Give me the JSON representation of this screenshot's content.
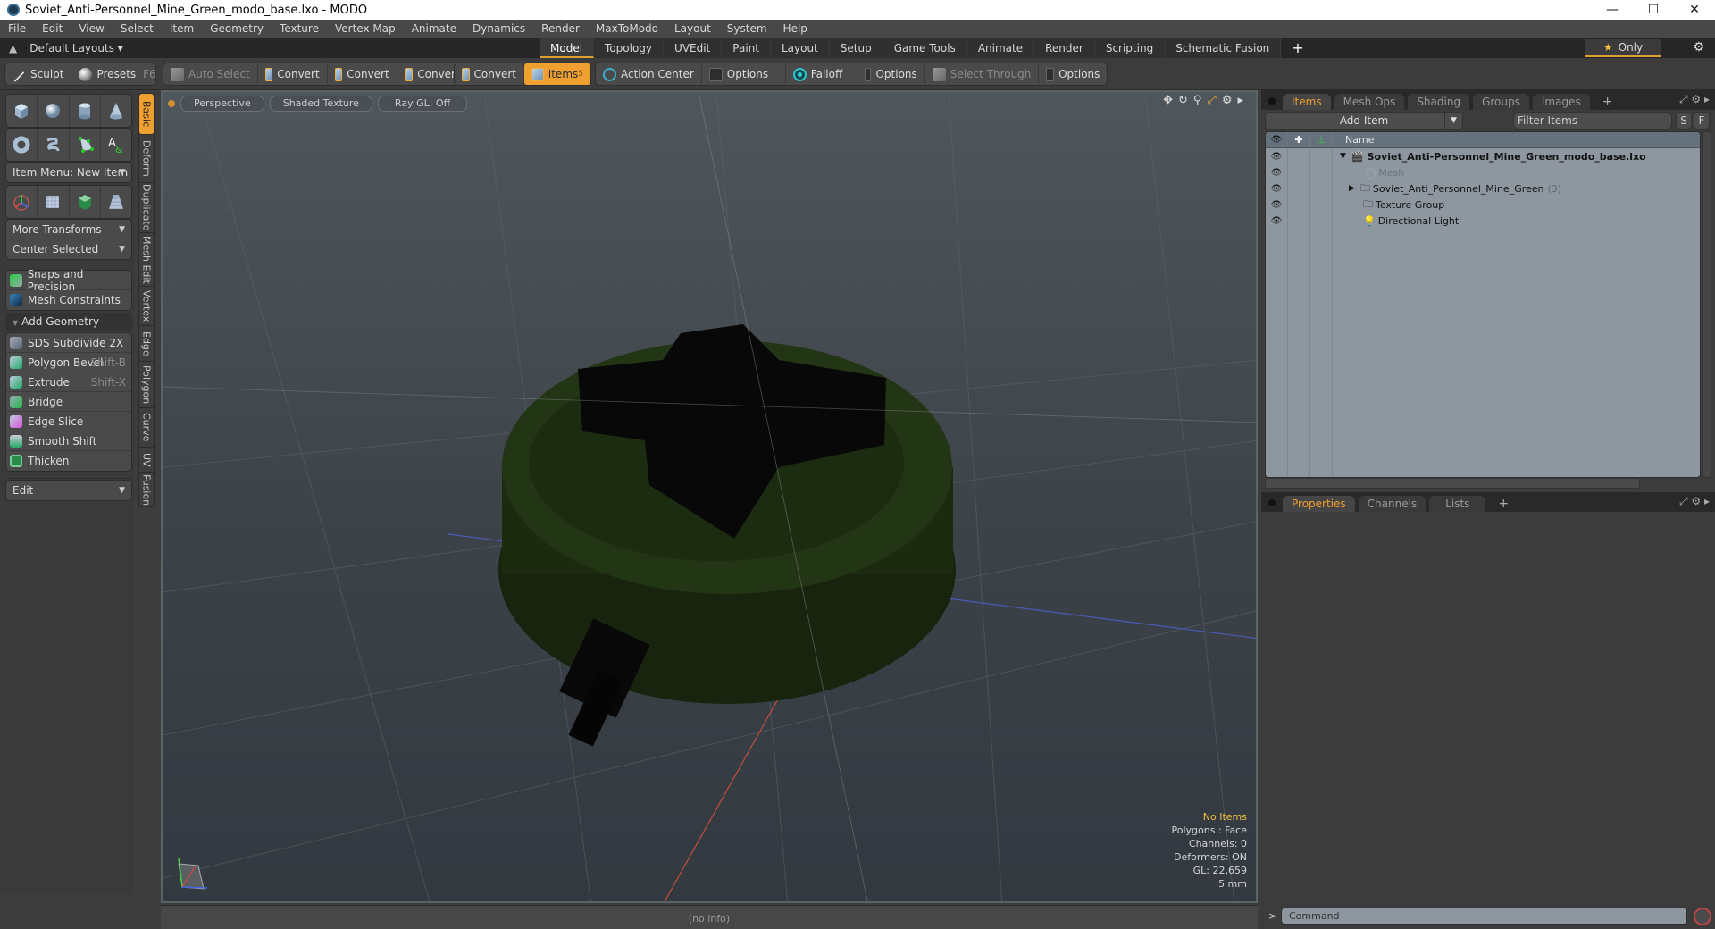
{
  "window": {
    "title": "Soviet_Anti-Personnel_Mine_Green_modo_base.lxo - MODO",
    "controls": [
      "minimize",
      "maximize",
      "close"
    ]
  },
  "menu": [
    "File",
    "Edit",
    "View",
    "Select",
    "Item",
    "Geometry",
    "Texture",
    "Vertex Map",
    "Animate",
    "Dynamics",
    "Render",
    "MaxToModo",
    "Layout",
    "System",
    "Help"
  ],
  "layout_bar": {
    "default_layouts": "Default Layouts ▾",
    "tabs": [
      "Model",
      "Topology",
      "UVEdit",
      "Paint",
      "Layout",
      "Setup",
      "Game Tools",
      "Animate",
      "Render",
      "Scripting",
      "Schematic Fusion"
    ],
    "active_tab": "Model",
    "add_tab": "+",
    "only_label": "Only"
  },
  "toolbar": {
    "sculpt": "Sculpt",
    "presets": "Presets",
    "presets_key": "F6",
    "auto_select": "Auto Select",
    "convert": "Convert",
    "items": "Items",
    "items_key": "5",
    "action_center": "Action Center",
    "options": "Options",
    "falloff": "Falloff",
    "select_through": "Select Through"
  },
  "left_panel": {
    "item_menu": "Item Menu: New Item",
    "more_transforms": "More Transforms",
    "center_selected": "Center Selected",
    "snaps": "Snaps and Precision",
    "constraints": "Mesh Constraints",
    "add_geometry": "Add Geometry",
    "tools": [
      {
        "label": "SDS Subdivide 2X",
        "shortcut": ""
      },
      {
        "label": "Polygon Bevel",
        "shortcut": "Shift-B"
      },
      {
        "label": "Extrude",
        "shortcut": "Shift-X"
      },
      {
        "label": "Bridge",
        "shortcut": ""
      },
      {
        "label": "Edge Slice",
        "shortcut": ""
      },
      {
        "label": "Smooth Shift",
        "shortcut": ""
      },
      {
        "label": "Thicken",
        "shortcut": ""
      }
    ],
    "edit_dropdown": "Edit",
    "vertical_tabs": [
      "Basic",
      "Deform",
      "Duplicate",
      "Mesh Edit",
      "Vertex",
      "Edge",
      "Polygon",
      "Curve",
      "UV",
      "Fusion"
    ],
    "active_vertical_tab": "Basic"
  },
  "viewport": {
    "view": "Perspective",
    "shading": "Shaded Texture",
    "raygl": "Ray GL: Off",
    "hud": {
      "selection": "No Items",
      "polygons": "Polygons : Face",
      "channels": "Channels: 0",
      "deformers": "Deformers: ON",
      "gl": "GL: 22,659",
      "scale": "5 mm"
    },
    "status": "(no info)"
  },
  "items_panel": {
    "tabs": [
      "Items",
      "Mesh Ops",
      "Shading",
      "Groups",
      "Images"
    ],
    "active_tab": "Items",
    "add_item": "Add Item",
    "filter_placeholder": "Filter Items",
    "s_btn": "S",
    "f_btn": "F",
    "column_name": "Name",
    "rows": [
      {
        "name": "Soviet_Anti-Personnel_Mine_Green_modo_base.lxo",
        "type": "scene",
        "expanded": true,
        "count": ""
      },
      {
        "name": "Mesh",
        "type": "mesh",
        "count": ""
      },
      {
        "name": "Soviet_Anti_Personnel_Mine_Green",
        "type": "group",
        "count": "(3)"
      },
      {
        "name": "Texture Group",
        "type": "group",
        "count": ""
      },
      {
        "name": "Directional Light",
        "type": "light",
        "count": ""
      }
    ]
  },
  "properties_panel": {
    "tabs": [
      "Properties",
      "Channels",
      "Lists"
    ],
    "active_tab": "Properties"
  },
  "command": {
    "placeholder": "Command"
  },
  "colors": {
    "accent": "#f0a030",
    "viewport_bg": "#3c4248",
    "mine_green": "#1c2a10"
  }
}
